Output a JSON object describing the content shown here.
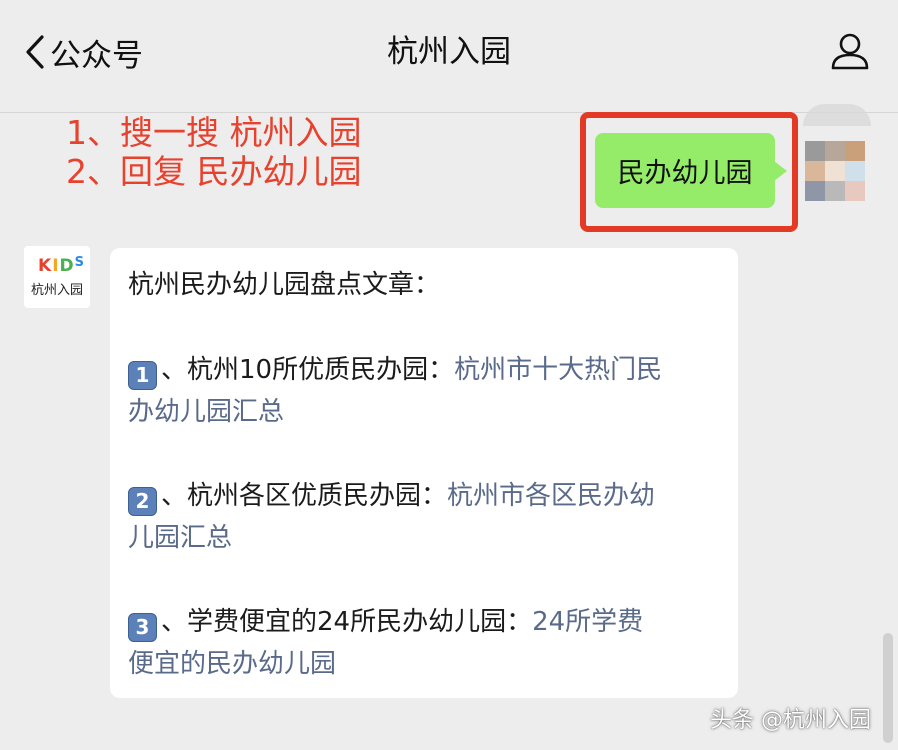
{
  "header": {
    "back_label": "公众号",
    "title": "杭州入园"
  },
  "annotation": {
    "line1": "1、搜一搜 杭州入园",
    "line2": "2、回复 民办幼儿园"
  },
  "sent_message": "民办幼儿园",
  "bot_avatar": {
    "logo_letters": [
      "K",
      "I",
      "D",
      "S"
    ],
    "name": "杭州入园"
  },
  "article": {
    "intro": "杭州民办幼儿园盘点文章：",
    "items": [
      {
        "number": "1",
        "prefix": "、杭州10所优质民办园：",
        "link_line1": "杭州市十大热门民",
        "link_line2": "办幼儿园汇总"
      },
      {
        "number": "2",
        "prefix": "、杭州各区优质民办园：",
        "link_line1": "杭州市各区民办幼",
        "link_line2": "儿园汇总"
      },
      {
        "number": "3",
        "prefix": "、学费便宜的24所民办幼儿园：",
        "link_line1": "24所学费",
        "link_line2": "便宜的民办幼儿园"
      }
    ]
  },
  "watermark": "头条 @杭州入园",
  "colors": {
    "annotation_red": "#e8422f",
    "highlight_border": "#e23a24",
    "sent_bubble_green": "#95ec69",
    "link_blue_gray": "#5a6a8a",
    "keycap_blue": "#5c81b8",
    "background": "#ededed",
    "avatar_mosaic": [
      "#9a9a9a",
      "#b7a79a",
      "#c9a07a",
      "#d9b79a",
      "#efe2d4",
      "#cfe0ea",
      "#8f96a8",
      "#b9b9b9",
      "#e8c9c0"
    ]
  }
}
